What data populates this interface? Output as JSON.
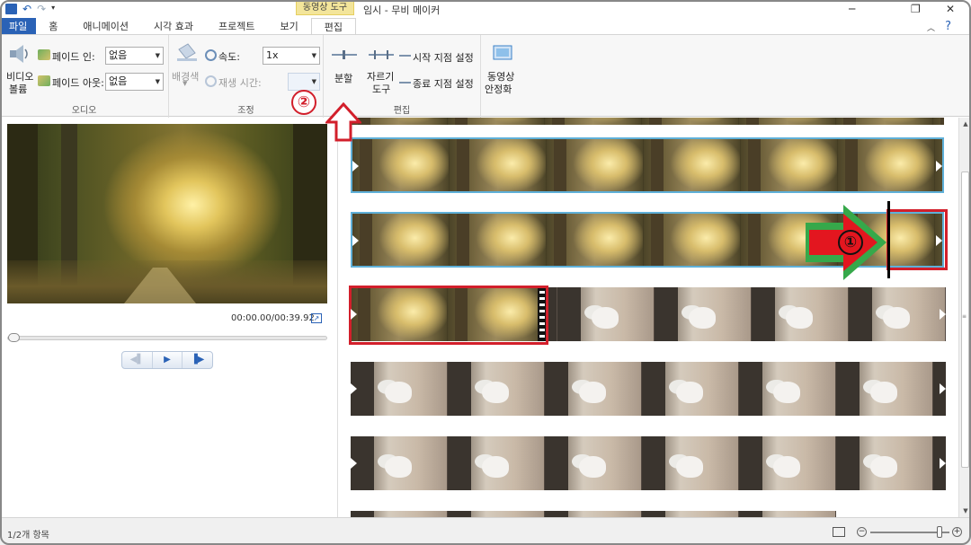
{
  "window": {
    "title": "임시 - 무비 메이커",
    "context_group": "동영상 도구",
    "help_symbol": "?",
    "minimize_symbol": "─",
    "restore_symbol": "❐",
    "close_symbol": "✕",
    "collapse_symbol": "︿"
  },
  "qat": {
    "undo": "↶",
    "redo": "↷",
    "menu": "▾"
  },
  "tabs": [
    {
      "label": "파일"
    },
    {
      "label": "홈"
    },
    {
      "label": "애니메이션"
    },
    {
      "label": "시각 효과"
    },
    {
      "label": "프로젝트"
    },
    {
      "label": "보기"
    },
    {
      "label": "편집"
    }
  ],
  "ribbon": {
    "audio": {
      "group_label": "오디오",
      "video_volume_line1": "비디오",
      "video_volume_line2": "볼륨",
      "fade_in_label": "페이드 인:",
      "fade_in_value": "없음",
      "fade_out_label": "페이드 아웃:",
      "fade_out_value": "없음"
    },
    "adjust": {
      "group_label": "조정",
      "background_label": "배경색",
      "speed_label": "속도:",
      "speed_value": "1x",
      "duration_label": "재생 시간:",
      "duration_value": ""
    },
    "edit": {
      "group_label": "편집",
      "split_label": "분할",
      "trim_line1": "자르기",
      "trim_line2": "도구",
      "set_start": "시작 지점 설정",
      "set_end": "종료 지점 설정"
    },
    "stabilize": {
      "line1": "동영상",
      "line2": "안정화"
    },
    "dropdown_arrow": "▼"
  },
  "preview": {
    "timecode": "00:00.00/00:39.92",
    "expand_icon": "↗",
    "seek_progress": 0.0,
    "prev_frame": "◀▌",
    "play": "▶",
    "next_frame": "▐▶"
  },
  "annotations": {
    "step1": "①",
    "step2": "②"
  },
  "colors": {
    "file_tab": "#2a62b6",
    "selection_red": "#d21f2b",
    "selection_blue": "#5fb0d8",
    "arrow_green": "#36a84a",
    "context_yellow": "#f3e59a"
  },
  "statusbar": {
    "item_count": "1/2개 항목",
    "zoom_minus": "−",
    "zoom_plus": "+",
    "zoom_level": 0.9
  }
}
